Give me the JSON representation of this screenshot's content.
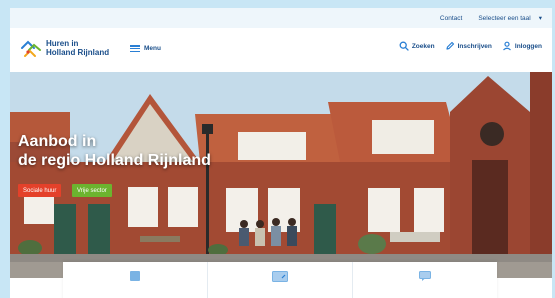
{
  "topbar": {
    "contact": "Contact",
    "language": "Selecteer een taal",
    "language_caret": "▾"
  },
  "header": {
    "logo_line1": "Huren in",
    "logo_line2": "Holland Rijnland",
    "menu_label": "Menu",
    "search_label": "Zoeken",
    "register_label": "Inschrijven",
    "login_label": "Inloggen"
  },
  "hero": {
    "title_line1": "Aanbod in",
    "title_line2": "de regio Holland Rijnland",
    "tag_social": "Sociale huur",
    "tag_free": "Vrije sector"
  },
  "colors": {
    "brand_blue": "#1a4e8a",
    "accent_blue": "#2a7fd4",
    "tag_red": "#e4412a",
    "tag_green": "#6cb42f"
  }
}
